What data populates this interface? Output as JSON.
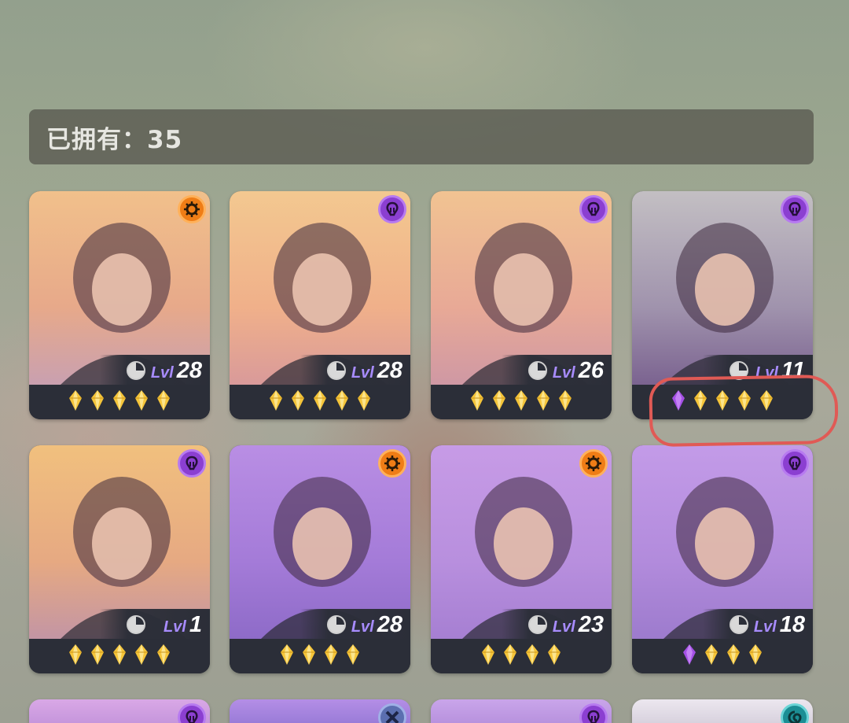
{
  "header": {
    "owned_label": "已拥有：35"
  },
  "level_prefix": "Lvl",
  "cards": [
    {
      "name": "card-1",
      "level": "28",
      "badge": "orange",
      "stars": 5,
      "crystals": 0,
      "bg": [
        "#f1c08b",
        "#e7a98a",
        "#c9a0b0"
      ]
    },
    {
      "name": "card-2",
      "level": "28",
      "badge": "purple",
      "stars": 5,
      "crystals": 0,
      "bg": [
        "#f3c890",
        "#f0b08a",
        "#d99a9a"
      ]
    },
    {
      "name": "card-3",
      "level": "26",
      "badge": "purple",
      "stars": 5,
      "crystals": 0,
      "bg": [
        "#f1c392",
        "#e8a996",
        "#cf98a4"
      ]
    },
    {
      "name": "card-4",
      "level": "11",
      "badge": "purple",
      "stars": 4,
      "crystals": 1,
      "bg": [
        "#c3bfc3",
        "#a093ad",
        "#7b6390"
      ]
    },
    {
      "name": "card-5",
      "level": "1",
      "badge": "purple",
      "stars": 5,
      "crystals": 0,
      "bg": [
        "#f1c07e",
        "#e6a982",
        "#c395a4"
      ]
    },
    {
      "name": "card-6",
      "level": "28",
      "badge": "orange",
      "stars": 4,
      "crystals": 0,
      "bg": [
        "#b98ee4",
        "#a47bd8",
        "#8e6bc8"
      ]
    },
    {
      "name": "card-7",
      "level": "23",
      "badge": "orange",
      "stars": 4,
      "crystals": 0,
      "bg": [
        "#c79be6",
        "#b88fde",
        "#a67fd2"
      ]
    },
    {
      "name": "card-8",
      "level": "18",
      "badge": "purple",
      "stars": 3,
      "crystals": 1,
      "bg": [
        "#c39be8",
        "#b28bdc",
        "#9d7bcd"
      ]
    }
  ],
  "partial_cards": [
    {
      "name": "card-9",
      "badge": "purple"
    },
    {
      "name": "card-10",
      "badge": "slate"
    },
    {
      "name": "card-11",
      "badge": "purple"
    },
    {
      "name": "card-12",
      "badge": "teal"
    }
  ],
  "colors": {
    "star": "#f5c53a",
    "crystal": "#a550e6",
    "annotation": "#e05a55"
  }
}
